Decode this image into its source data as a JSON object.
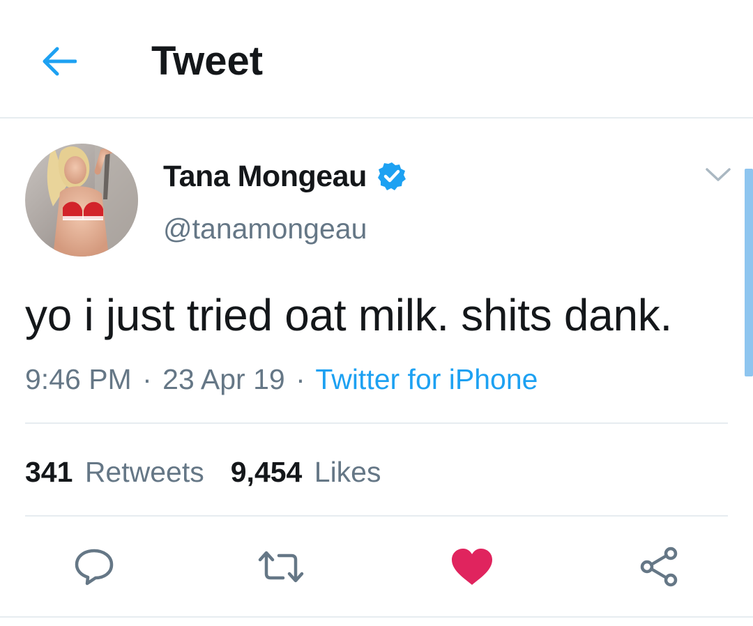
{
  "header": {
    "title": "Tweet",
    "back_icon": "arrow-left-icon"
  },
  "tweet": {
    "author": {
      "name": "Tana Mongeau",
      "handle": "@tanamongeau",
      "verified": true,
      "avatar_icon": "avatar-photo"
    },
    "text": "yo i just tried oat milk. shits dank.",
    "time": "9:46 PM",
    "date": "23 Apr 19",
    "source": "Twitter for iPhone",
    "separator": "·",
    "menu_icon": "chevron-down-icon"
  },
  "stats": {
    "retweets_count": "341",
    "retweets_label": "Retweets",
    "likes_count": "9,454",
    "likes_label": "Likes"
  },
  "actions": [
    {
      "icon": "reply-icon"
    },
    {
      "icon": "retweet-icon"
    },
    {
      "icon": "like-icon",
      "active": true
    },
    {
      "icon": "share-icon"
    }
  ],
  "colors": {
    "accent": "#1da1f2",
    "text_primary": "#14171a",
    "text_secondary": "#657786",
    "like_active": "#e0245e",
    "divider": "#e6ecf0"
  }
}
